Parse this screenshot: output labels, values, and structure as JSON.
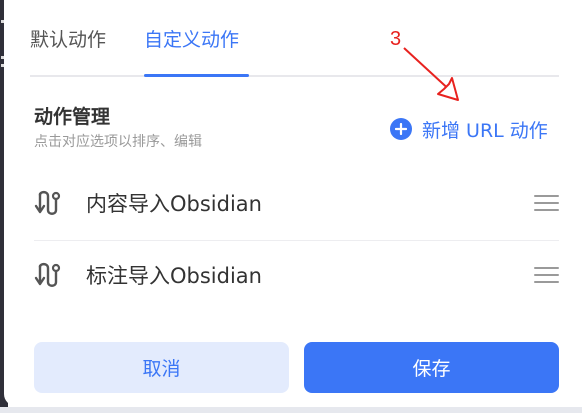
{
  "tabs": [
    {
      "label": "默认动作",
      "active": false
    },
    {
      "label": "自定义动作",
      "active": true
    }
  ],
  "annotation": {
    "label": "3",
    "color": "#e8221f"
  },
  "section": {
    "title": "动作管理",
    "subtitle": "点击对应选项以排序、编辑"
  },
  "add_action": {
    "label": "新增 URL 动作",
    "icon": "plus-circle-icon"
  },
  "actions": [
    {
      "label": "内容导入Obsidian",
      "icon": "route-icon"
    },
    {
      "label": "标注导入Obsidian",
      "icon": "route-icon"
    }
  ],
  "buttons": {
    "cancel": "取消",
    "save": "保存"
  },
  "colors": {
    "accent": "#3b76f6",
    "accent_light": "#e3ebfd",
    "text": "#333333",
    "muted": "#9a9a9a",
    "divider": "#e8e8ec"
  }
}
